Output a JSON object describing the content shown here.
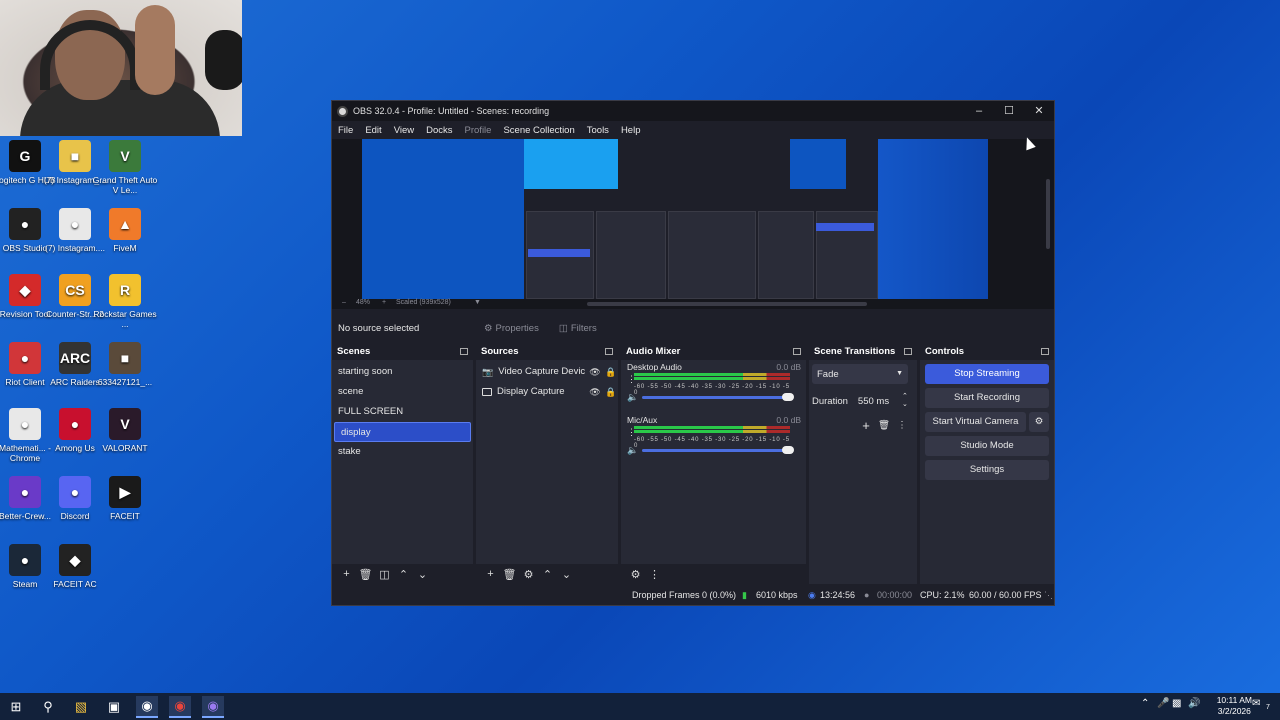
{
  "desktop": {
    "icons": [
      {
        "label": "Logitech G HUB",
        "glyph": "G",
        "color": "#111111",
        "icon": "logitech-g-hub-icon"
      },
      {
        "label": "(7) Instagram_...",
        "glyph": "■",
        "color": "#e8c34a",
        "icon": "file-icon"
      },
      {
        "label": "Grand Theft Auto V Le...",
        "glyph": "V",
        "color": "#3b7a3b",
        "icon": "gta-icon"
      },
      {
        "label": "OBS Studio",
        "glyph": "●",
        "color": "#222222",
        "icon": "obs-icon"
      },
      {
        "label": "(7) Instagram....",
        "glyph": "●",
        "color": "#e8e8e8",
        "icon": "chrome-icon"
      },
      {
        "label": "FiveM",
        "glyph": "▲",
        "color": "#f07a2a",
        "icon": "fivem-icon"
      },
      {
        "label": "Revision Tool",
        "glyph": "◆",
        "color": "#d42a2a",
        "icon": "revision-tool-icon"
      },
      {
        "label": "Counter-Str... 2",
        "glyph": "CS",
        "color": "#f0a020",
        "icon": "counter-strike-icon"
      },
      {
        "label": "Rockstar Games ...",
        "glyph": "R",
        "color": "#f2c12e",
        "icon": "rockstar-icon"
      },
      {
        "label": "Riot Client",
        "glyph": "●",
        "color": "#d13639",
        "icon": "riot-client-icon"
      },
      {
        "label": "ARC Raiders",
        "glyph": "ARC",
        "color": "#333333",
        "icon": "arc-raiders-icon"
      },
      {
        "label": "633427121_...",
        "glyph": "■",
        "color": "#5a4a3a",
        "icon": "image-file-icon"
      },
      {
        "label": "Mathemati... - Chrome",
        "glyph": "●",
        "color": "#e8e8e8",
        "icon": "chrome-icon"
      },
      {
        "label": "Among Us",
        "glyph": "●",
        "color": "#c8102e",
        "icon": "among-us-icon"
      },
      {
        "label": "VALORANT",
        "glyph": "V",
        "color": "#2a1a2a",
        "icon": "valorant-icon"
      },
      {
        "label": "Better-Crew...",
        "glyph": "●",
        "color": "#6a3ac8",
        "icon": "better-crewlink-icon"
      },
      {
        "label": "Discord",
        "glyph": "●",
        "color": "#5865f2",
        "icon": "discord-icon"
      },
      {
        "label": "FACEIT",
        "glyph": "▶",
        "color": "#1a1a1a",
        "icon": "faceit-icon"
      },
      {
        "label": "Steam",
        "glyph": "●",
        "color": "#1b2838",
        "icon": "steam-icon"
      },
      {
        "label": "FACEIT AC",
        "glyph": "◆",
        "color": "#222222",
        "icon": "faceit-ac-icon"
      }
    ]
  },
  "obs": {
    "title": "OBS 32.0.4 - Profile: Untitled - Scenes: recording",
    "menu": [
      "File",
      "Edit",
      "View",
      "Docks",
      "Profile",
      "Scene Collection",
      "Tools",
      "Help"
    ],
    "zoom": "48%",
    "scaled": "Scaled (939x528)",
    "no_source": "No source selected",
    "properties": "Properties",
    "filters": "Filters",
    "scenes": {
      "title": "Scenes",
      "items": [
        "starting soon",
        "scene",
        "FULL SCREEN",
        "display",
        "stake"
      ]
    },
    "sources": {
      "title": "Sources",
      "items": [
        "Video Capture Devic",
        "Display Capture"
      ]
    },
    "mixer": {
      "title": "Audio Mixer",
      "scale": "-60 -55 -50 -45 -40 -35 -30 -25 -20 -15 -10 -5 0",
      "channels": [
        {
          "name": "Desktop Audio",
          "db": "0.0 dB"
        },
        {
          "name": "Mic/Aux",
          "db": "0.0 dB"
        }
      ]
    },
    "transitions": {
      "title": "Scene Transitions",
      "selected": "Fade",
      "duration_label": "Duration",
      "duration_value": "550 ms"
    },
    "controls": {
      "title": "Controls",
      "stop_streaming": "Stop Streaming",
      "start_recording": "Start Recording",
      "start_virtual_camera": "Start Virtual Camera",
      "studio_mode": "Studio Mode",
      "settings": "Settings"
    },
    "status": {
      "dropped_frames": "Dropped Frames 0 (0.0%)",
      "bitrate": "6010 kbps",
      "stream_time": "13:24:56",
      "record_time": "00:00:00",
      "cpu": "CPU: 2.1%",
      "fps": "60.00 / 60.00 FPS"
    }
  },
  "taskbar": {
    "time": "10:11 AM",
    "date": "3/2/2026",
    "notification_count": "7"
  }
}
